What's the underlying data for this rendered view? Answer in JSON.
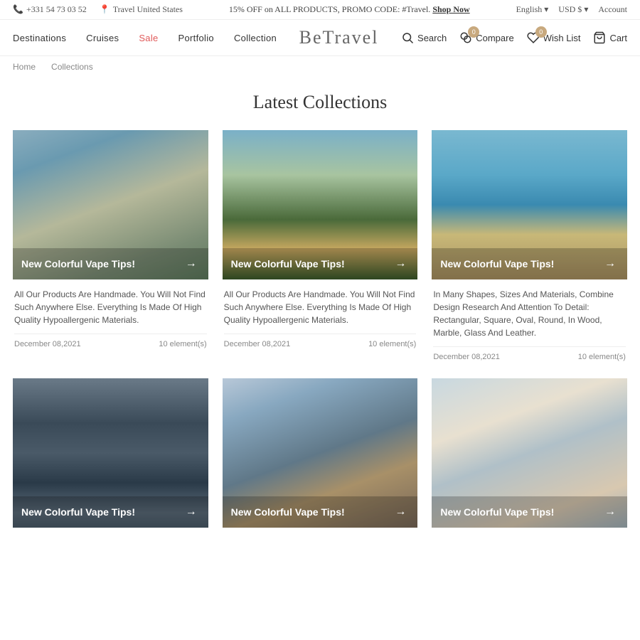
{
  "topbar": {
    "phone": "+331 54 73 03 52",
    "location": "Travel United States",
    "promo_text": "15% OFF on ALL PRODUCTS, PROMO CODE: #Travel.",
    "promo_link": "Shop Now",
    "language": "English",
    "currency": "USD $",
    "account": "Account"
  },
  "nav": {
    "links": [
      {
        "label": "Destinations",
        "class": ""
      },
      {
        "label": "Cruises",
        "class": ""
      },
      {
        "label": "Sale",
        "class": "sale"
      },
      {
        "label": "Portfolio",
        "class": ""
      },
      {
        "label": "Collection",
        "class": ""
      }
    ],
    "logo": "BeTravel",
    "search_label": "Search",
    "compare_label": "Compare",
    "compare_count": "0",
    "wishlist_label": "Wish List",
    "wishlist_count": "0",
    "cart_label": "Cart"
  },
  "breadcrumb": {
    "home": "Home",
    "current": "Collections"
  },
  "page": {
    "title": "Latest Collections"
  },
  "collections": [
    {
      "title": "New Colorful Vape Tips!",
      "description": "All Our Products Are Handmade. You Will Not Find Such Anywhere Else. Everything Is Made Of High Quality Hypoallergenic Materials.",
      "date": "December 08,2021",
      "elements": "10 element(s)",
      "img_class": "img-rocks-sea"
    },
    {
      "title": "New Colorful Vape Tips!",
      "description": "All Our Products Are Handmade. You Will Not Find Such Anywhere Else. Everything Is Made Of High Quality Hypoallergenic Materials.",
      "date": "December 08,2021",
      "elements": "10 element(s)",
      "img_class": "img-resort-night"
    },
    {
      "title": "New Colorful Vape Tips!",
      "description": "In Many Shapes, Sizes And Materials, Combine Design Research And Attention To Detail: Rectangular, Square, Oval, Round, In Wood, Marble, Glass And Leather.",
      "date": "December 08,2021",
      "elements": "10 element(s)",
      "img_class": "img-rocky-beach"
    },
    {
      "title": "New Colorful Vape Tips!",
      "description": "",
      "date": "",
      "elements": "",
      "img_class": "img-temple"
    },
    {
      "title": "New Colorful Vape Tips!",
      "description": "",
      "date": "",
      "elements": "",
      "img_class": "img-cliff-resort"
    },
    {
      "title": "New Colorful Vape Tips!",
      "description": "",
      "date": "",
      "elements": "",
      "img_class": "img-window-view"
    }
  ]
}
